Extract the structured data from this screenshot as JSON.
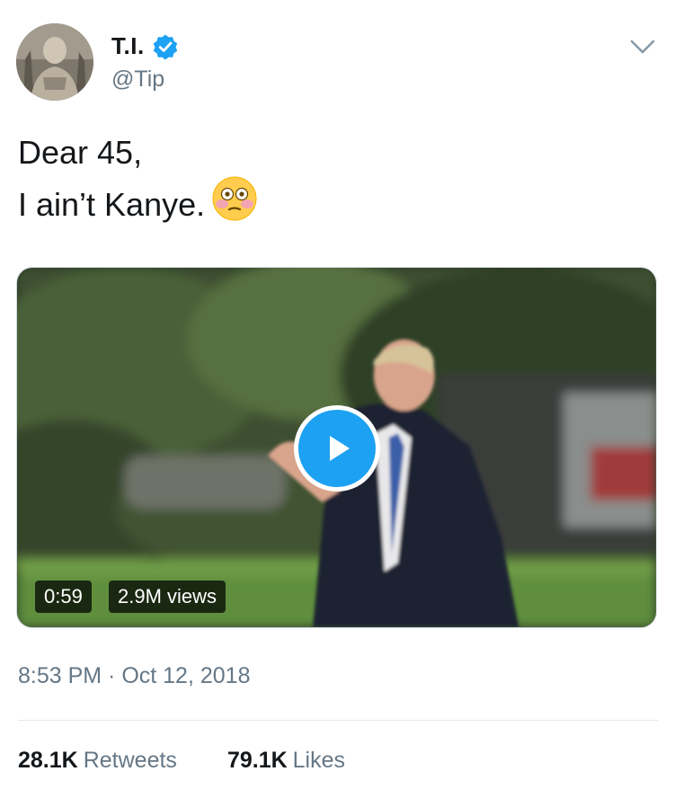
{
  "author": {
    "name": "T.I.",
    "handle": "@Tip",
    "verified": true
  },
  "tweet": {
    "lines": [
      "Dear 45,",
      "I ain’t Kanye."
    ],
    "emoji": "flushed-face"
  },
  "media": {
    "duration": "0:59",
    "views": "2.9M views"
  },
  "timestamp": "8:53 PM · Oct 12, 2018",
  "stats": {
    "retweets_count": "28.1K",
    "retweets_label": "Retweets",
    "likes_count": "79.1K",
    "likes_label": "Likes"
  },
  "colors": {
    "accent": "#1da1f2",
    "secondary_text": "#657786",
    "primary_text": "#14171a"
  }
}
